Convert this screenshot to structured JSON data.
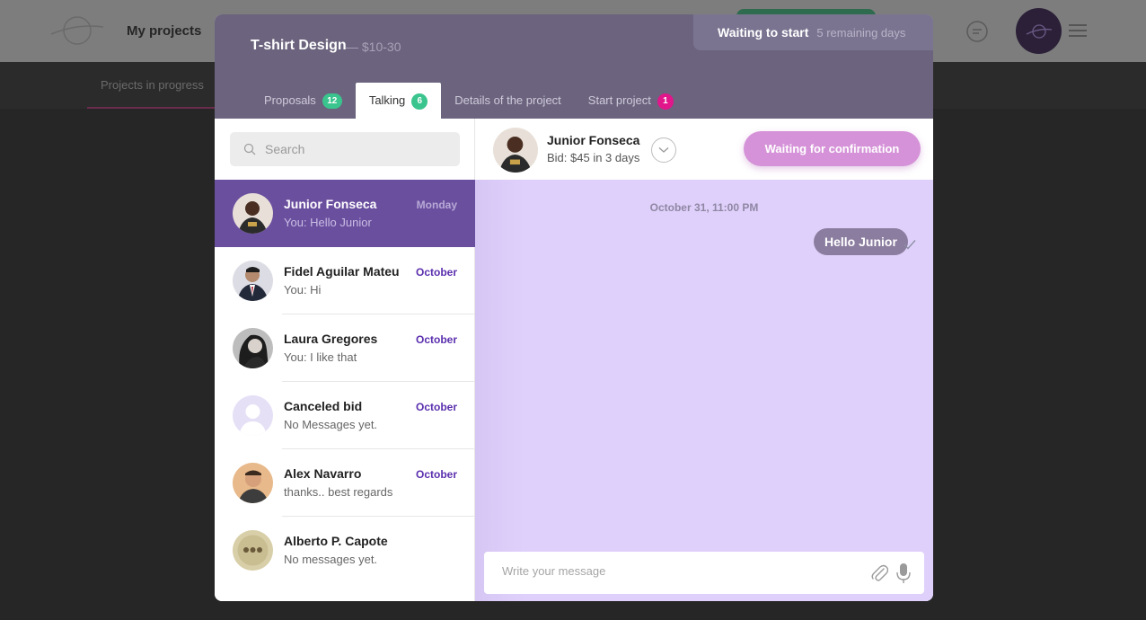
{
  "background": {
    "title": "My projects",
    "subtab": "Projects in progress"
  },
  "modal": {
    "title": "T-shirt Design",
    "price": "— $10-30",
    "status": "Waiting to start",
    "status_sub": "5 remaining days",
    "tabs": [
      {
        "label": "Proposals",
        "badge": "12"
      },
      {
        "label": "Talking",
        "badge": "6"
      },
      {
        "label": "Details of the project",
        "badge": ""
      },
      {
        "label": "Start project",
        "badge": "1"
      }
    ]
  },
  "search": {
    "placeholder": "Search"
  },
  "conversations": [
    {
      "name": "Junior Fonseca",
      "message": "You: Hello Junior",
      "date": "Monday"
    },
    {
      "name": "Fidel Aguilar Mateu",
      "message": "You: Hi",
      "date": "October"
    },
    {
      "name": "Laura Gregores",
      "message": "You: I like that",
      "date": "October"
    },
    {
      "name": "Canceled bid",
      "message": "No Messages yet.",
      "date": "October"
    },
    {
      "name": "Alex Navarro",
      "message": "thanks.. best regards",
      "date": "October"
    },
    {
      "name": "Alberto P. Capote",
      "message": "No messages yet.",
      "date": ""
    }
  ],
  "chat": {
    "name": "Junior Fonseca",
    "bid": "Bid: $45 in 3 days",
    "confirm_label": "Waiting for confirmation",
    "date": "October 31, 11:00 PM",
    "message": "Hello Junior",
    "composer_placeholder": "Write your message"
  },
  "colors": {
    "accent": "#6b4f9f",
    "chat_bg": "#dfd0fb",
    "badge_green": "#3ac48e",
    "badge_pink": "#e0168a",
    "confirm": "#d592d8"
  }
}
